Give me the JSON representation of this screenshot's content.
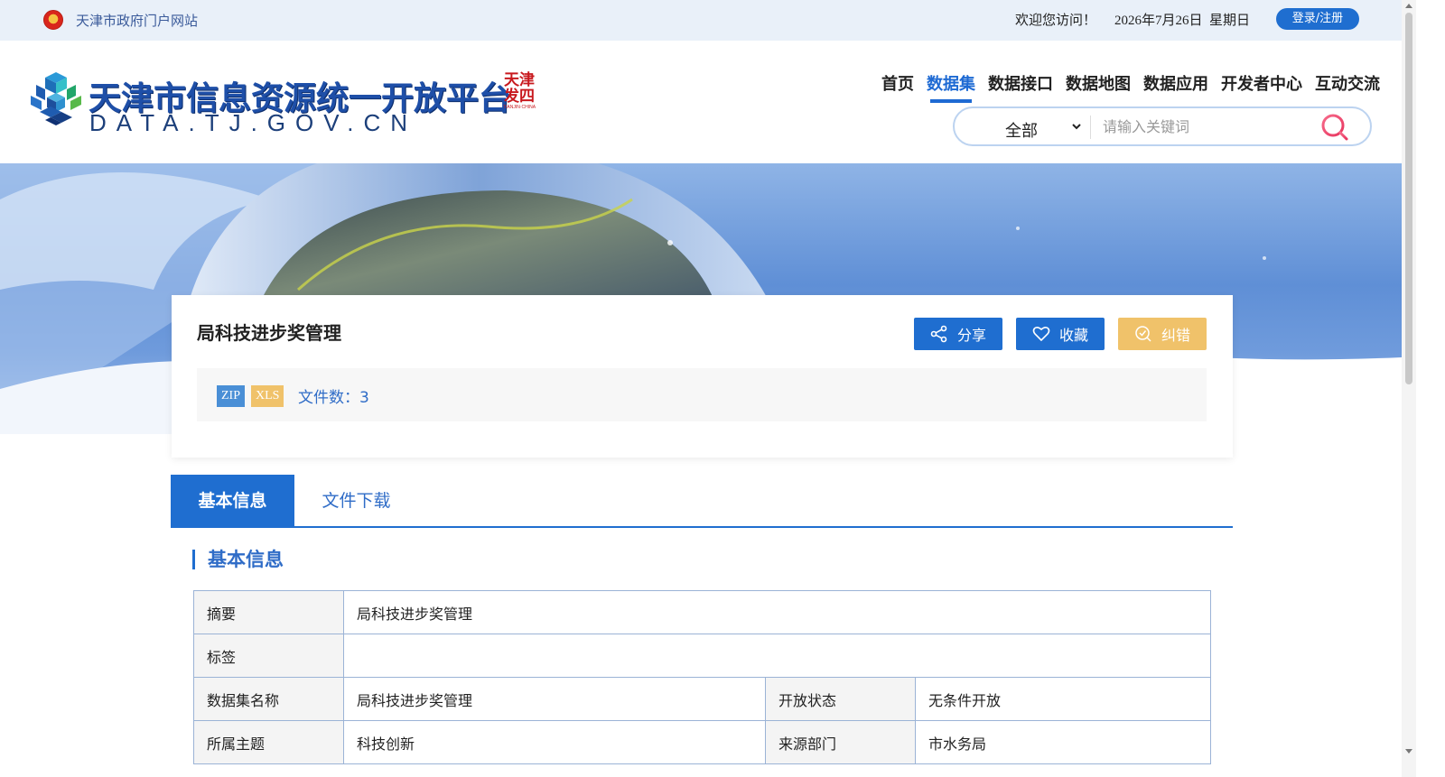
{
  "topbar": {
    "gov_portal_link": "天津市政府门户网站",
    "welcome": "欢迎您访问！",
    "date": "2026年7月26日  星期日",
    "login_label": "登录/注册"
  },
  "header": {
    "logo_title": "天津市信息资源统一开放平台",
    "logo_domain": "DATA.TJ.GOV.CN",
    "seal_text": [
      "天津",
      "发",
      "四",
      "TIANJIN·CHINA"
    ],
    "nav": [
      "首页",
      "数据集",
      "数据接口",
      "数据地图",
      "数据应用",
      "开发者中心",
      "互动交流"
    ],
    "active_nav": "数据集",
    "search": {
      "category": "全部",
      "placeholder": "请输入关键词"
    }
  },
  "dataset": {
    "title": "局科技进步奖管理",
    "actions": {
      "share": "分享",
      "favorite": "收藏",
      "correct": "纠错"
    },
    "formats": [
      "ZIP",
      "XLS"
    ],
    "file_count": "文件数：3"
  },
  "tabs": {
    "basic": "基本信息",
    "download": "文件下载"
  },
  "info": {
    "section_title": "基本信息",
    "rows": {
      "summary_label": "摘要",
      "summary_value": "局科技进步奖管理",
      "tags_label": "标签",
      "tags_value": "",
      "name_label": "数据集名称",
      "name_value": "局科技进步奖管理",
      "open_label": "开放状态",
      "open_value": "无条件开放",
      "theme_label": "所属主题",
      "theme_value": "科技创新",
      "source_label": "来源部门",
      "source_value": "市水务局"
    }
  },
  "colors": {
    "primary": "#1f6ed0",
    "accent_yellow": "#f0c26a",
    "link_blue": "#2f6cc7",
    "topbar_bg": "#e9f0f9"
  }
}
